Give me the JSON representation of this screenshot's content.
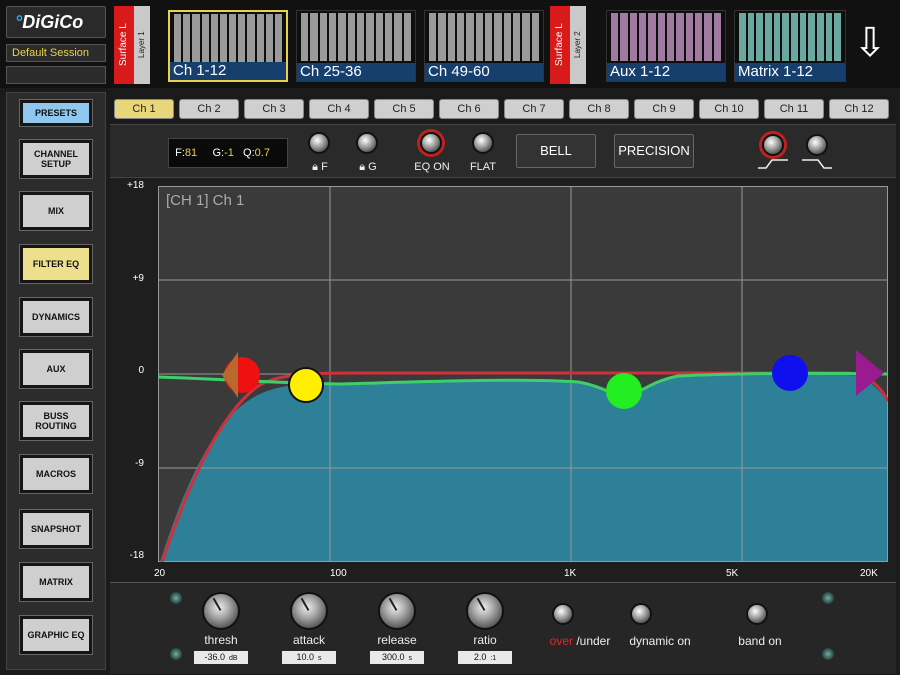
{
  "brand": {
    "logo_text": "DiGiCo"
  },
  "session": {
    "name": "Default Session"
  },
  "top_banks": {
    "surface_label": "Surface L",
    "layers": [
      "Layer 1",
      "Layer 2"
    ],
    "banks": [
      {
        "label": "Ch 1-12",
        "color": "#9a9a9a",
        "selected": true
      },
      {
        "label": "Ch 25-36",
        "color": "#9a9a9a",
        "selected": false
      },
      {
        "label": "Ch 49-60",
        "color": "#9a9a9a",
        "selected": false
      },
      {
        "label": "Aux 1-12",
        "color": "#a07aa0",
        "selected": false
      },
      {
        "label": "Matrix 1-12",
        "color": "#6aa8a0",
        "selected": false
      }
    ]
  },
  "nav": {
    "items": [
      {
        "label": "PRESETS",
        "state": "blue"
      },
      {
        "label": "CHANNEL SETUP",
        "state": ""
      },
      {
        "label": "MIX",
        "state": ""
      },
      {
        "label": "FILTER EQ",
        "state": "yellow"
      },
      {
        "label": "DYNAMICS",
        "state": ""
      },
      {
        "label": "AUX",
        "state": ""
      },
      {
        "label": "BUSS ROUTING",
        "state": ""
      },
      {
        "label": "MACROS",
        "state": ""
      },
      {
        "label": "SNAPSHOT",
        "state": ""
      },
      {
        "label": "MATRIX",
        "state": ""
      },
      {
        "label": "GRAPHIC EQ",
        "state": ""
      }
    ]
  },
  "tabs": [
    "Ch 1",
    "Ch 2",
    "Ch 3",
    "Ch 4",
    "Ch 5",
    "Ch 6",
    "Ch 7",
    "Ch 8",
    "Ch 9",
    "Ch 10",
    "Ch 11",
    "Ch 12"
  ],
  "eq_controls": {
    "f_label": "F:",
    "f_value": "81",
    "g_label": "G:",
    "g_value": "-1",
    "q_label": "Q:",
    "q_value": "0.7",
    "lock_f": "F",
    "lock_g": "G",
    "eq_on": "EQ ON",
    "flat": "FLAT",
    "bell": "BELL",
    "precision": "PRECISION"
  },
  "graph": {
    "title": "[CH 1]  Ch 1",
    "y_ticks": [
      "+18",
      "+9",
      "0",
      "-9",
      "-18"
    ],
    "x_ticks": [
      "20",
      "100",
      "1K",
      "5K",
      "20K"
    ],
    "colors": {
      "fill": "#2e7f98",
      "eq_curve": "#3ecf6a",
      "filter_curve": "#d0303a"
    }
  },
  "dynamics": {
    "knobs": [
      {
        "label": "thresh",
        "value": "-36.0",
        "unit": "dB"
      },
      {
        "label": "attack",
        "value": "10.0",
        "unit": "s"
      },
      {
        "label": "release",
        "value": "300.0",
        "unit": "s"
      },
      {
        "label": "ratio",
        "value": "2.0",
        "unit": ":1"
      }
    ],
    "over_label": "over",
    "under_label": " /under",
    "dynamic_on": "dynamic on",
    "band_on": "band on"
  }
}
